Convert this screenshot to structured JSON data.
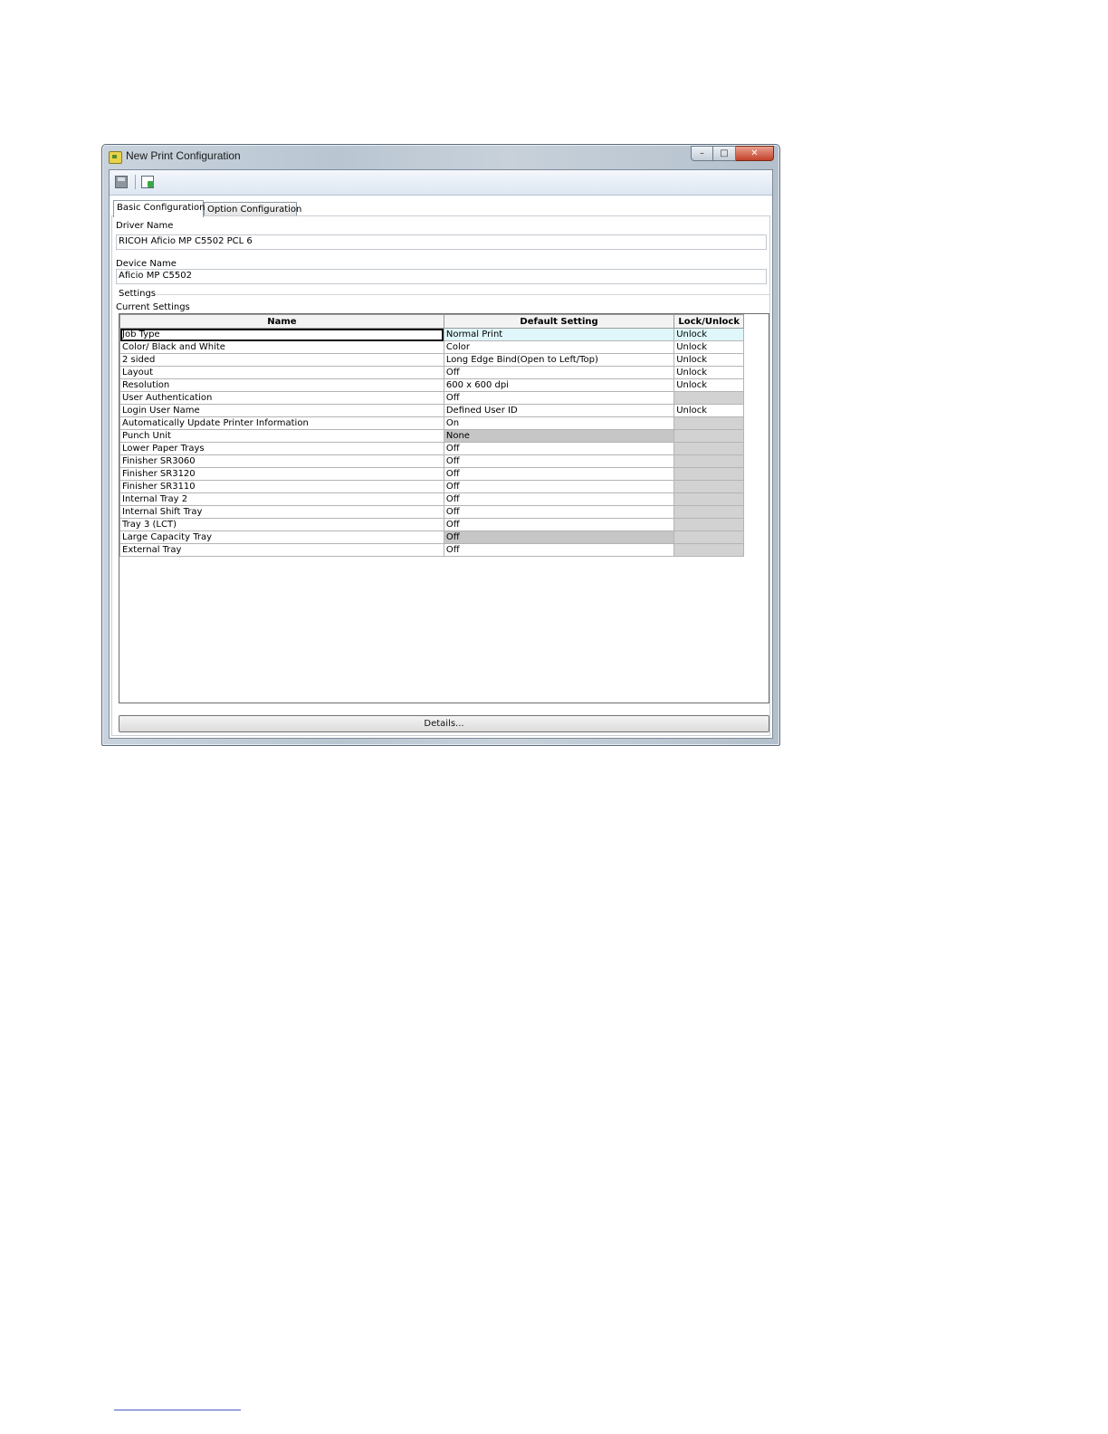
{
  "window": {
    "title": "New Print Configuration",
    "controls": {
      "minimize": "–",
      "maximize": "□",
      "close": "✕"
    }
  },
  "toolbar": {
    "icons": [
      "save-icon",
      "export-icon"
    ]
  },
  "tabs": [
    {
      "label": "Basic Configuration",
      "active": true
    },
    {
      "label": "Option Configuration",
      "active": false
    }
  ],
  "form": {
    "driver_name_label": "Driver Name",
    "driver_name_value": "RICOH Aficio MP C5502 PCL 6",
    "device_name_label": "Device Name",
    "device_name_value": "Aficio MP C5502",
    "settings_label": "Settings",
    "current_settings_label": "Current Settings"
  },
  "table": {
    "headers": {
      "name": "Name",
      "default": "Default Setting",
      "lock": "Lock/Unlock"
    },
    "rows": [
      {
        "name": "Job Type",
        "default": "Normal Print",
        "lock": "Unlock"
      },
      {
        "name": "Color/ Black and White",
        "default": "Color",
        "lock": "Unlock"
      },
      {
        "name": "2 sided",
        "default": "Long Edge Bind(Open to Left/Top)",
        "lock": "Unlock"
      },
      {
        "name": "Layout",
        "default": "Off",
        "lock": "Unlock"
      },
      {
        "name": "Resolution",
        "default": "600 x 600 dpi",
        "lock": "Unlock"
      },
      {
        "name": "User Authentication",
        "default": "Off",
        "lock": ""
      },
      {
        "name": "Login User Name",
        "default": "Defined User ID",
        "lock": "Unlock"
      },
      {
        "name": "Automatically Update Printer Information",
        "default": "On",
        "lock": ""
      },
      {
        "name": "Punch Unit",
        "default": "None",
        "lock": ""
      },
      {
        "name": "Lower Paper Trays",
        "default": "Off",
        "lock": ""
      },
      {
        "name": "Finisher SR3060",
        "default": "Off",
        "lock": ""
      },
      {
        "name": "Finisher SR3120",
        "default": "Off",
        "lock": ""
      },
      {
        "name": "Finisher SR3110",
        "default": "Off",
        "lock": ""
      },
      {
        "name": "Internal Tray 2",
        "default": "Off",
        "lock": ""
      },
      {
        "name": "Internal Shift Tray",
        "default": "Off",
        "lock": ""
      },
      {
        "name": "Tray 3 (LCT)",
        "default": "Off",
        "lock": ""
      },
      {
        "name": "Large Capacity Tray",
        "default": "Off",
        "lock": ""
      },
      {
        "name": "External Tray",
        "default": "Off",
        "lock": ""
      }
    ]
  },
  "buttons": {
    "details": "Details..."
  },
  "colors": {
    "selected_row": "#dff7fb",
    "disabled_cell": "#c6c6c6"
  }
}
